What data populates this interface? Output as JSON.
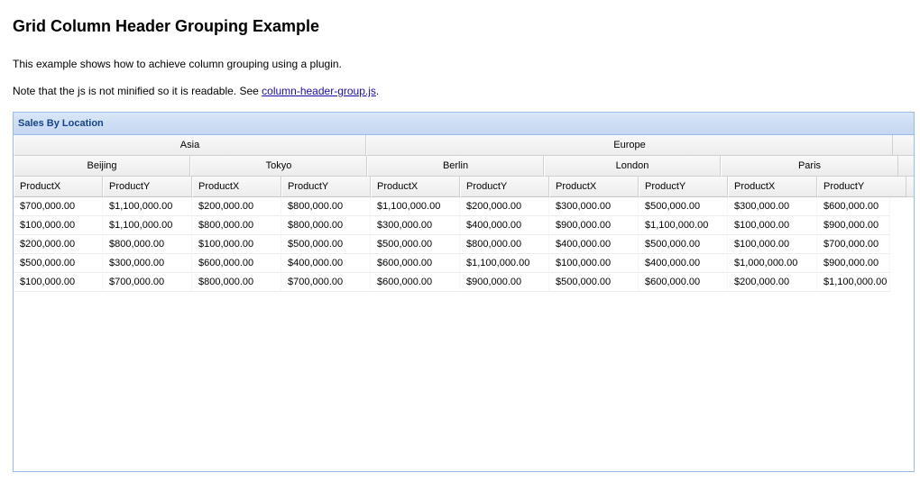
{
  "page": {
    "title": "Grid Column Header Grouping Example",
    "intro": "This example shows how to achieve column grouping using a plugin.",
    "note_prefix": "Note that the js is not minified so it is readable. See ",
    "note_link": "column-header-group.js",
    "note_suffix": "."
  },
  "panel": {
    "title": "Sales By Location"
  },
  "grid": {
    "continents": [
      "Asia",
      "Europe"
    ],
    "cities": [
      "Beijing",
      "Tokyo",
      "Berlin",
      "London",
      "Paris"
    ],
    "columns": [
      "ProductX",
      "ProductY",
      "ProductX",
      "ProductY",
      "ProductX",
      "ProductY",
      "ProductX",
      "ProductY",
      "ProductX",
      "ProductY"
    ],
    "rows": [
      [
        "$700,000.00",
        "$1,100,000.00",
        "$200,000.00",
        "$800,000.00",
        "$1,100,000.00",
        "$200,000.00",
        "$300,000.00",
        "$500,000.00",
        "$300,000.00",
        "$600,000.00"
      ],
      [
        "$100,000.00",
        "$1,100,000.00",
        "$800,000.00",
        "$800,000.00",
        "$300,000.00",
        "$400,000.00",
        "$900,000.00",
        "$1,100,000.00",
        "$100,000.00",
        "$900,000.00"
      ],
      [
        "$200,000.00",
        "$800,000.00",
        "$100,000.00",
        "$500,000.00",
        "$500,000.00",
        "$800,000.00",
        "$400,000.00",
        "$500,000.00",
        "$100,000.00",
        "$700,000.00"
      ],
      [
        "$500,000.00",
        "$300,000.00",
        "$600,000.00",
        "$400,000.00",
        "$600,000.00",
        "$1,100,000.00",
        "$100,000.00",
        "$400,000.00",
        "$1,000,000.00",
        "$900,000.00"
      ],
      [
        "$100,000.00",
        "$700,000.00",
        "$800,000.00",
        "$700,000.00",
        "$600,000.00",
        "$900,000.00",
        "$500,000.00",
        "$600,000.00",
        "$200,000.00",
        "$1,100,000.00"
      ]
    ]
  }
}
